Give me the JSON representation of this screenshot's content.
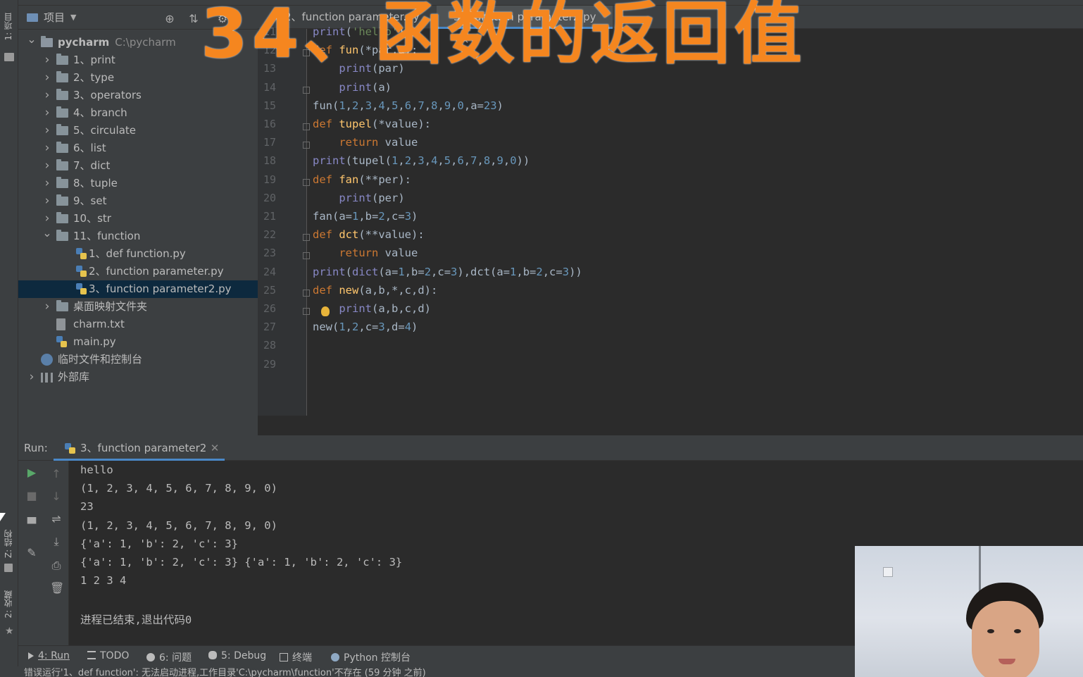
{
  "overlay": {
    "title": "34、函数的返回值"
  },
  "left_stripe": {
    "project_tab": "1: 项目",
    "structure_tab": "Z: 结构",
    "favorites_tab": "2: 收藏"
  },
  "project_panel": {
    "header_label": "项目",
    "tree": [
      {
        "label": "pycharm",
        "path": "C:\\pycharm",
        "type": "folder",
        "level": 0,
        "expanded": true
      },
      {
        "label": "1、print",
        "type": "folder",
        "level": 1,
        "expanded": false
      },
      {
        "label": "2、type",
        "type": "folder",
        "level": 1,
        "expanded": false
      },
      {
        "label": "3、operators",
        "type": "folder",
        "level": 1,
        "expanded": false
      },
      {
        "label": "4、branch",
        "type": "folder",
        "level": 1,
        "expanded": false
      },
      {
        "label": "5、circulate",
        "type": "folder",
        "level": 1,
        "expanded": false
      },
      {
        "label": "6、list",
        "type": "folder",
        "level": 1,
        "expanded": false
      },
      {
        "label": "7、dict",
        "type": "folder",
        "level": 1,
        "expanded": false
      },
      {
        "label": "8、tuple",
        "type": "folder",
        "level": 1,
        "expanded": false
      },
      {
        "label": "9、set",
        "type": "folder",
        "level": 1,
        "expanded": false
      },
      {
        "label": "10、str",
        "type": "folder",
        "level": 1,
        "expanded": false
      },
      {
        "label": "11、function",
        "type": "folder",
        "level": 1,
        "expanded": true
      },
      {
        "label": "1、def function.py",
        "type": "python-file",
        "level": 2
      },
      {
        "label": "2、function parameter.py",
        "type": "python-file",
        "level": 2
      },
      {
        "label": "3、function parameter2.py",
        "type": "python-file",
        "level": 2,
        "selected": true
      },
      {
        "label": "桌面映射文件夹",
        "type": "folder",
        "level": 1,
        "expanded": false
      },
      {
        "label": "charm.txt",
        "type": "text-file",
        "level": 1
      },
      {
        "label": "main.py",
        "type": "python-file",
        "level": 1
      },
      {
        "label": "临时文件和控制台",
        "type": "scratches",
        "level": 0
      },
      {
        "label": "外部库",
        "type": "library",
        "level": 0,
        "expanded": false
      }
    ]
  },
  "editor": {
    "tabs": [
      {
        "label": "2、function parameter.py",
        "active": false
      },
      {
        "label": "3、function parameter2.py",
        "active": true
      }
    ],
    "lines": [
      {
        "no": "11",
        "code": "print('hello')"
      },
      {
        "no": "12",
        "code": "def fun(*par,a):"
      },
      {
        "no": "13",
        "code": "    print(par)"
      },
      {
        "no": "14",
        "code": "    print(a)"
      },
      {
        "no": "15",
        "code": "fun(1,2,3,4,5,6,7,8,9,0,a=23)"
      },
      {
        "no": "16",
        "code": "def tupel(*value):"
      },
      {
        "no": "17",
        "code": "    return value"
      },
      {
        "no": "18",
        "code": "print(tupel(1,2,3,4,5,6,7,8,9,0))"
      },
      {
        "no": "19",
        "code": "def fan(**per):"
      },
      {
        "no": "20",
        "code": "    print(per)"
      },
      {
        "no": "21",
        "code": "fan(a=1,b=2,c=3)"
      },
      {
        "no": "22",
        "code": "def dct(**value):"
      },
      {
        "no": "23",
        "code": "    return value"
      },
      {
        "no": "24",
        "code": "print(dict(a=1,b=2,c=3),dct(a=1,b=2,c=3))"
      },
      {
        "no": "25",
        "code": "def new(a,b,*,c,d):"
      },
      {
        "no": "26",
        "code": "    print(a,b,c,d)"
      },
      {
        "no": "27",
        "code": "new(1,2,c=3,d=4)"
      },
      {
        "no": "28",
        "code": ""
      },
      {
        "no": "29",
        "code": ""
      }
    ]
  },
  "run_panel": {
    "label": "Run:",
    "tab_label": "3、function parameter2",
    "output": [
      "hello",
      "(1, 2, 3, 4, 5, 6, 7, 8, 9, 0)",
      "23",
      "(1, 2, 3, 4, 5, 6, 7, 8, 9, 0)",
      "{'a': 1, 'b': 2, 'c': 3}",
      "{'a': 1, 'b': 2, 'c': 3} {'a': 1, 'b': 2, 'c': 3}",
      "1 2 3 4",
      "",
      "进程已结束,退出代码0"
    ]
  },
  "bottom_bar": {
    "tabs": [
      {
        "label": "4: Run",
        "icon": "play-icon"
      },
      {
        "label": "TODO",
        "icon": "list-icon"
      },
      {
        "label": "6: 问题",
        "icon": "problems-icon"
      },
      {
        "label": "5: Debug",
        "icon": "bug-icon"
      },
      {
        "label": "终端",
        "icon": "terminal-icon"
      },
      {
        "label": "Python 控制台",
        "icon": "python-console-icon"
      }
    ]
  },
  "status_bar": {
    "message": "错误运行'1、def function': 无法启动进程,工作目录'C:\\pycharm\\function'不存在 (59 分钟 之前)"
  },
  "colors": {
    "accent": "#4a88c7",
    "overlay": "#f5861f",
    "keyword": "#cc7832",
    "function": "#ffc66d",
    "number": "#6897bb"
  }
}
